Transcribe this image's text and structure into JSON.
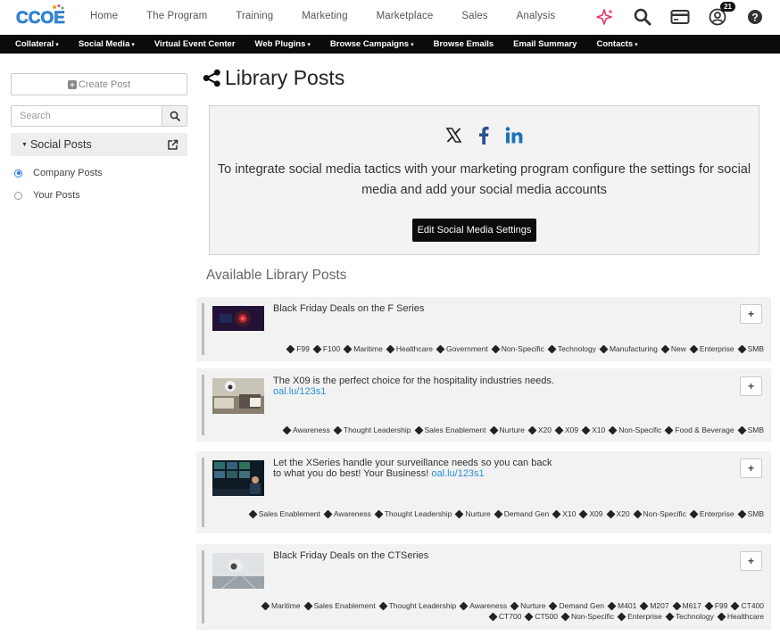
{
  "header": {
    "logo_text": "CCOE",
    "nav": [
      "Home",
      "The Program",
      "Training",
      "Marketing",
      "Marketplace",
      "Sales",
      "Analysis"
    ],
    "notification_count": "21"
  },
  "subnav": [
    {
      "label": "Collateral",
      "caret": true
    },
    {
      "label": "Social Media",
      "caret": true
    },
    {
      "label": "Virtual Event Center",
      "caret": false
    },
    {
      "label": "Web Plugins",
      "caret": true
    },
    {
      "label": "Browse Campaigns",
      "caret": true
    },
    {
      "label": "Browse Emails",
      "caret": false
    },
    {
      "label": "Email Summary",
      "caret": false
    },
    {
      "label": "Contacts",
      "caret": true
    }
  ],
  "sidebar": {
    "create_label": "Create Post",
    "search_placeholder": "Search",
    "section_label": "Social Posts",
    "options": [
      {
        "label": "Company Posts",
        "selected": true
      },
      {
        "label": "Your Posts",
        "selected": false
      }
    ]
  },
  "main": {
    "title": "Library Posts",
    "notice_text": "To integrate social media tactics with your marketing program configure the settings for social media and add your social media accounts",
    "edit_button": "Edit Social Media Settings",
    "available_heading": "Available Library Posts"
  },
  "posts": [
    {
      "text": "Black Friday Deals on the F Series",
      "link": "",
      "tags": [
        "F99",
        "F100",
        "Maritime",
        "Healthcare",
        "Government",
        "Non-Specific",
        "Technology",
        "Manufacturing",
        "New",
        "Enterprise",
        "SMB"
      ]
    },
    {
      "text": "The X09 is the perfect choice for the hospitality industries needs.",
      "link": "oal.lu/123s1",
      "tags": [
        "Awareness",
        "Thought Leadership",
        "Sales Enablement",
        "Nurture",
        "X20",
        "X09",
        "X10",
        "Non-Specific",
        "Food & Beverage",
        "SMB"
      ]
    },
    {
      "text": "Let the XSeries handle your surveillance needs so you can back to what you do best! Your Business!",
      "link": "oal.lu/123s1",
      "tags": [
        "Sales Enablement",
        "Awareness",
        "Thought Leadership",
        "Nurture",
        "Demand Gen",
        "X10",
        "X09",
        "X20",
        "Non-Specific",
        "Enterprise",
        "SMB"
      ]
    },
    {
      "text": "Black Friday Deals on the CTSeries",
      "link": "",
      "tags": [
        "Maritime",
        "Sales Enablement",
        "Thought Leadership",
        "Awareness",
        "Nurture",
        "Demand Gen",
        "M401",
        "M207",
        "M617",
        "F99",
        "CT400",
        "CT700",
        "CT500",
        "Non-Specific",
        "Enterprise",
        "Technology",
        "Healthcare"
      ]
    }
  ]
}
